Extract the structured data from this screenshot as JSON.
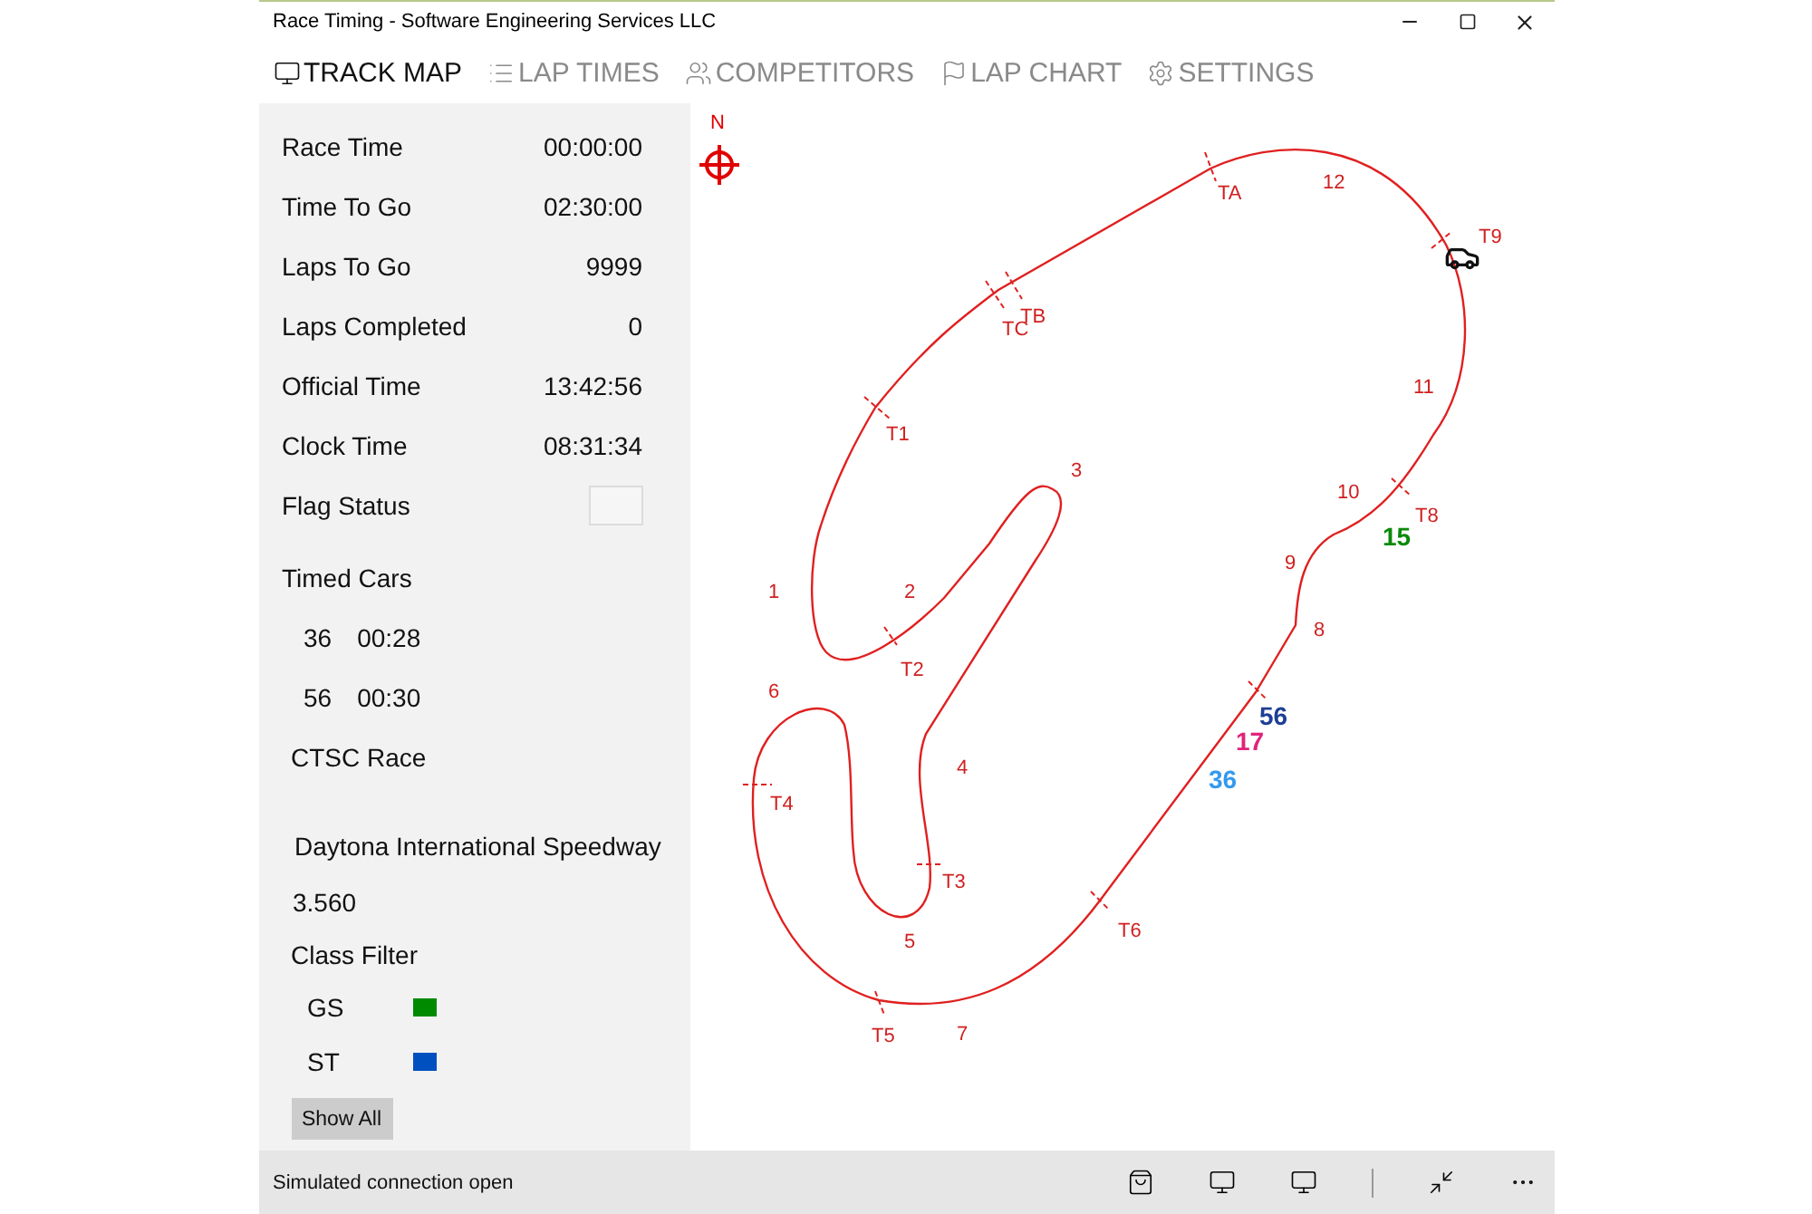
{
  "window": {
    "title": "Race Timing - Software Engineering Services LLC"
  },
  "tabs": [
    {
      "label": "TRACK MAP",
      "selected": true
    },
    {
      "label": "LAP TIMES",
      "selected": false
    },
    {
      "label": "COMPETITORS",
      "selected": false
    },
    {
      "label": "LAP CHART",
      "selected": false
    },
    {
      "label": "SETTINGS",
      "selected": false
    }
  ],
  "sidebar": {
    "stats": [
      {
        "label": "Race Time",
        "value": "00:00:00"
      },
      {
        "label": "Time To Go",
        "value": "02:30:00"
      },
      {
        "label": "Laps To Go",
        "value": "9999"
      },
      {
        "label": "Laps Completed",
        "value": "0"
      },
      {
        "label": "Official Time",
        "value": "13:42:56"
      },
      {
        "label": "Clock Time",
        "value": "08:31:34"
      }
    ],
    "flag_status": {
      "label": "Flag Status"
    },
    "timed_cars": {
      "label": "Timed Cars",
      "cars": [
        {
          "number": "36",
          "gap": "00:28"
        },
        {
          "number": "56",
          "gap": "00:30"
        }
      ]
    },
    "race_name": "CTSC Race",
    "track_name": "Daytona International Speedway",
    "track_length": "3.560",
    "class_filter": {
      "label": "Class Filter",
      "classes": [
        {
          "name": "GS",
          "color": "#008a00"
        },
        {
          "name": "ST",
          "color": "#0050c0"
        }
      ]
    },
    "show_all_button": "Show All"
  },
  "map": {
    "compass_label": "N",
    "timing_lines": [
      {
        "label": "T1"
      },
      {
        "label": "TC"
      },
      {
        "label": "TB"
      },
      {
        "label": "TA"
      },
      {
        "label": "T9"
      },
      {
        "label": "T8"
      },
      {
        "label": "T6"
      },
      {
        "label": "T5"
      },
      {
        "label": "T4"
      },
      {
        "label": "T3"
      },
      {
        "label": "T2"
      }
    ],
    "turns": [
      {
        "label": "1"
      },
      {
        "label": "2"
      },
      {
        "label": "3"
      },
      {
        "label": "4"
      },
      {
        "label": "5"
      },
      {
        "label": "6"
      },
      {
        "label": "7"
      },
      {
        "label": "8"
      },
      {
        "label": "9"
      },
      {
        "label": "10"
      },
      {
        "label": "11"
      },
      {
        "label": "12"
      }
    ],
    "cars": [
      {
        "number": "15",
        "color": "#0a8a0a"
      },
      {
        "number": "56",
        "color": "#1c3f94"
      },
      {
        "number": "17",
        "color": "#e0247a"
      },
      {
        "number": "36",
        "color": "#3399ee"
      }
    ]
  },
  "status_bar": {
    "text": "Simulated connection open"
  }
}
